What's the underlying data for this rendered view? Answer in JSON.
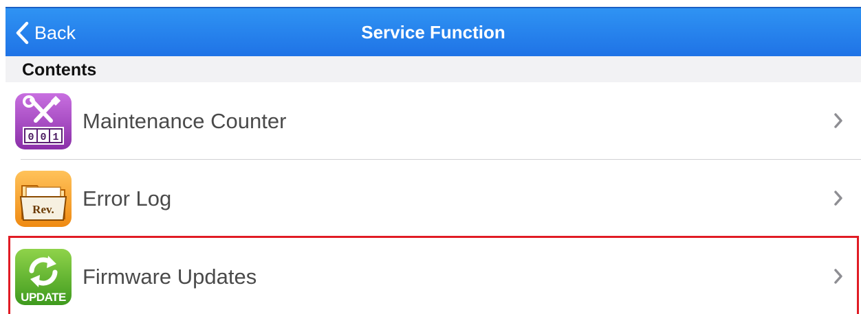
{
  "navbar": {
    "back_label": "Back",
    "title": "Service Function",
    "background_color": "#2a86ee"
  },
  "section": {
    "title": "Contents"
  },
  "items": [
    {
      "label": "Maintenance Counter",
      "icon": "maintenance-counter-icon",
      "icon_text": "001"
    },
    {
      "label": "Error Log",
      "icon": "error-log-folder-icon",
      "icon_text": "Rev."
    },
    {
      "label": "Firmware Updates",
      "icon": "firmware-update-icon",
      "icon_text": "UPDATE",
      "highlighted": true
    }
  ],
  "highlight_color": "#e01b24"
}
